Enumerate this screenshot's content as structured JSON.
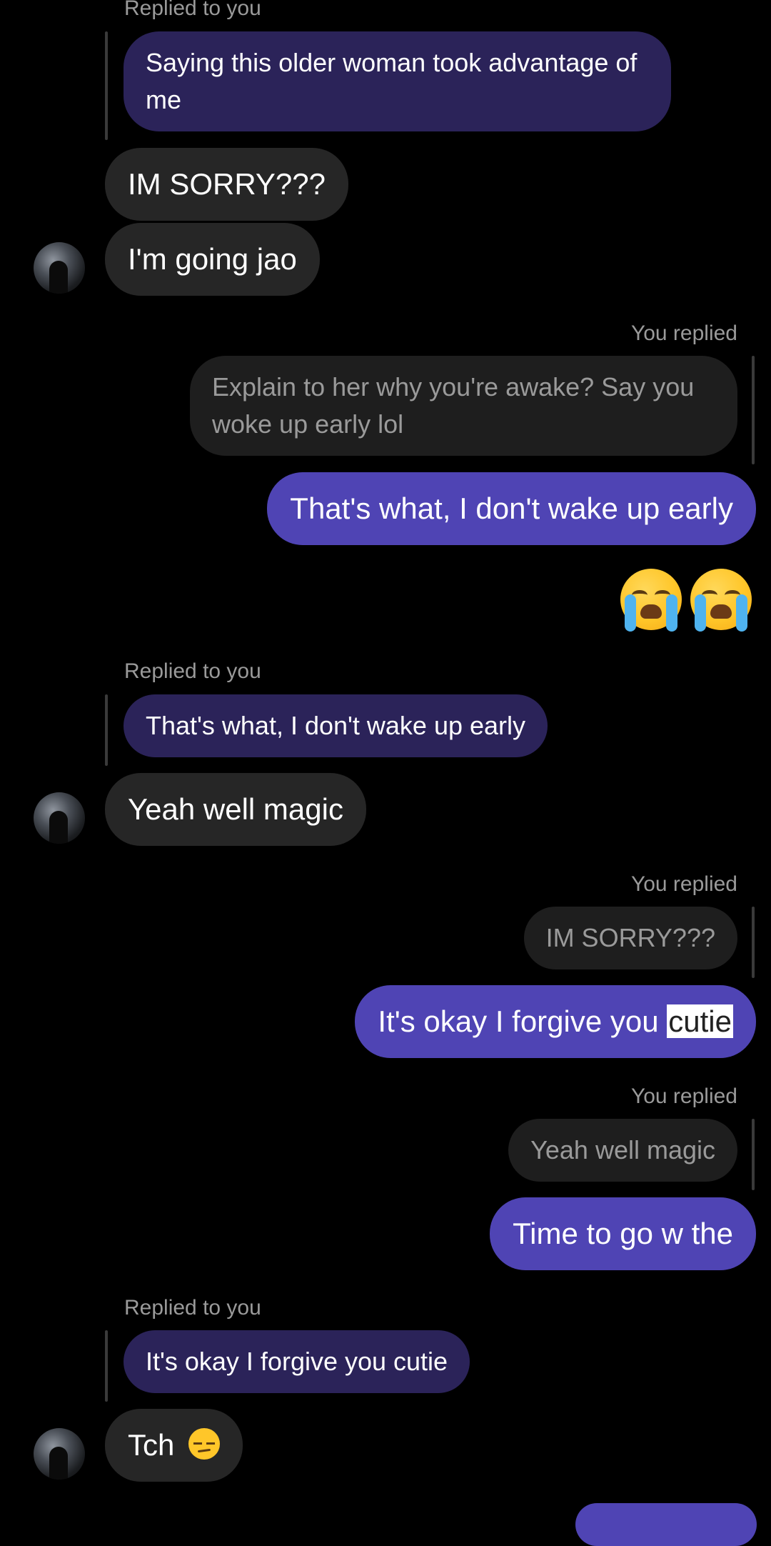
{
  "labels": {
    "replied_to_you": "Replied to you",
    "you_replied": "You replied"
  },
  "messages": {
    "m1_quote": "Saying this older woman took advantage of me",
    "m2": "IM SORRY???",
    "m3": "I'm going jao",
    "m4_quote": "Explain to her why you're awake? Say you woke up early lol",
    "m4": "That's what, I don't wake up early",
    "m5_emoji": "😭😭",
    "m6_quote": "That's what, I don't wake up early",
    "m6": "Yeah well magic",
    "m7_quote": "IM SORRY???",
    "m7_text": "It's okay I forgive you ",
    "m7_selected": "cutie",
    "m8_quote": "Yeah well magic",
    "m8": "Time to go w the",
    "m9_quote": "It's okay I forgive you cutie",
    "m9_text": "Tch",
    "m9_emoji": "😒"
  },
  "colors": {
    "background": "#000000",
    "incoming_bubble": "#262626",
    "outgoing_bubble": "#4f44b4",
    "quoted_reply_bubble": "#2b2359",
    "quoted_own_bubble": "#1e1e1e",
    "meta_text": "#9a9a9a"
  }
}
